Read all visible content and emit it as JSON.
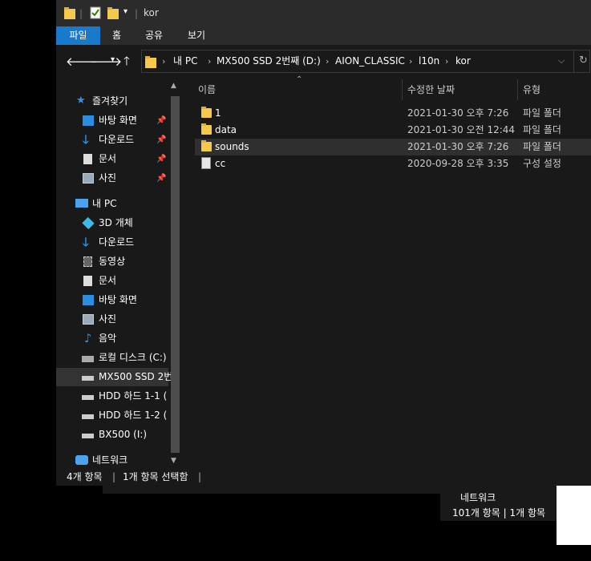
{
  "background": {
    "window2_status": "101개 항목  |  1개 항목",
    "window2_nav": "네트워크"
  },
  "titlebar": {
    "title": "kor"
  },
  "ribbon": {
    "tabs": [
      "파일",
      "홈",
      "공유",
      "보기"
    ]
  },
  "address": {
    "crumbs": [
      "내 PC",
      "MX500 SSD 2번째 (D:)",
      "AION_CLASSIC",
      "l10n",
      "kor"
    ]
  },
  "nav": {
    "quick_access": "즐겨찾기",
    "quick_items": [
      "바탕 화면",
      "다운로드",
      "문서",
      "사진"
    ],
    "this_pc": "내 PC",
    "pc_items": [
      "3D 개체",
      "다운로드",
      "동영상",
      "문서",
      "바탕 화면",
      "사진",
      "음악",
      "로컬 디스크 (C:)",
      "MX500 SSD 2번",
      "HDD 하드 1-1 (",
      "HDD 하드 1-2 (",
      "BX500 (I:)"
    ],
    "network": "네트워크"
  },
  "columns": {
    "name": "이름",
    "modified": "수정한 날짜",
    "type": "유형"
  },
  "files": [
    {
      "name": "1",
      "modified": "2021-01-30 오후 7:26",
      "type": "파일 폴더",
      "icon": "folder-icon"
    },
    {
      "name": "data",
      "modified": "2021-01-30 오전 12:44",
      "type": "파일 폴더",
      "icon": "folder-icon"
    },
    {
      "name": "sounds",
      "modified": "2021-01-30 오후 7:26",
      "type": "파일 폴더",
      "icon": "folder-icon"
    },
    {
      "name": "cc",
      "modified": "2020-09-28 오후 3:35",
      "type": "구성 설정",
      "icon": "config-file-icon"
    }
  ],
  "status": {
    "count": "4개 항목",
    "selected": "1개 항목 선택함"
  },
  "colors": {
    "accent": "#1979ca",
    "window_bg": "#191919",
    "chrome_bg": "#2b2b2b",
    "folder": "#f5c94d"
  }
}
